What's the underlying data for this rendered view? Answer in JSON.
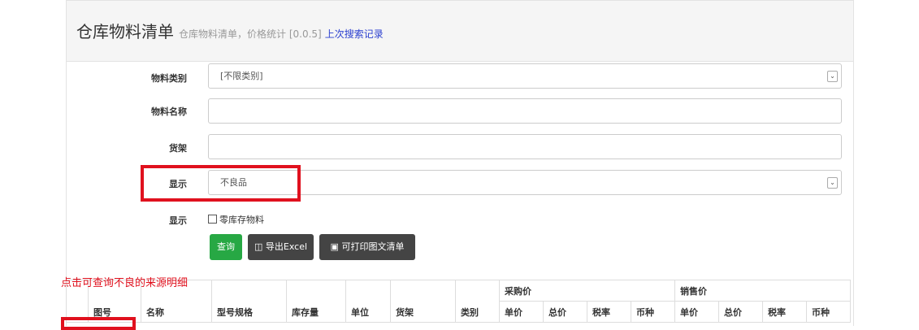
{
  "header": {
    "title": "仓库物料清单",
    "subtitle": "仓库物料清单，价格统计 [0.0.5]",
    "history_link": "上次搜索记录"
  },
  "form": {
    "category_label": "物料类别",
    "category_value": "[不限类别]",
    "name_label": "物料名称",
    "name_value": "",
    "shelf_label": "货架",
    "shelf_value": "",
    "display_label": "显示",
    "display_value": "不良品",
    "display2_label": "显示",
    "zero_stock_checkbox": "零库存物料"
  },
  "buttons": {
    "query": "查询",
    "export": "导出Excel",
    "print": "可打印图文清单"
  },
  "annotation": "点击可查询不良的来源明细",
  "table": {
    "columns": [
      "图号",
      "名称",
      "型号规格",
      "库存量",
      "单位",
      "货架",
      "类别"
    ],
    "purchase_group": "采购价",
    "sales_group": "销售价",
    "purchase_sub": [
      "单价",
      "总价",
      "税率",
      "币种"
    ],
    "sales_sub": [
      "单价",
      "总价",
      "税率",
      "币种"
    ]
  },
  "colors": {
    "highlight": "#e0111e",
    "link": "#2a3fcf",
    "query_button": "#27a844",
    "dark_button": "#444444"
  }
}
